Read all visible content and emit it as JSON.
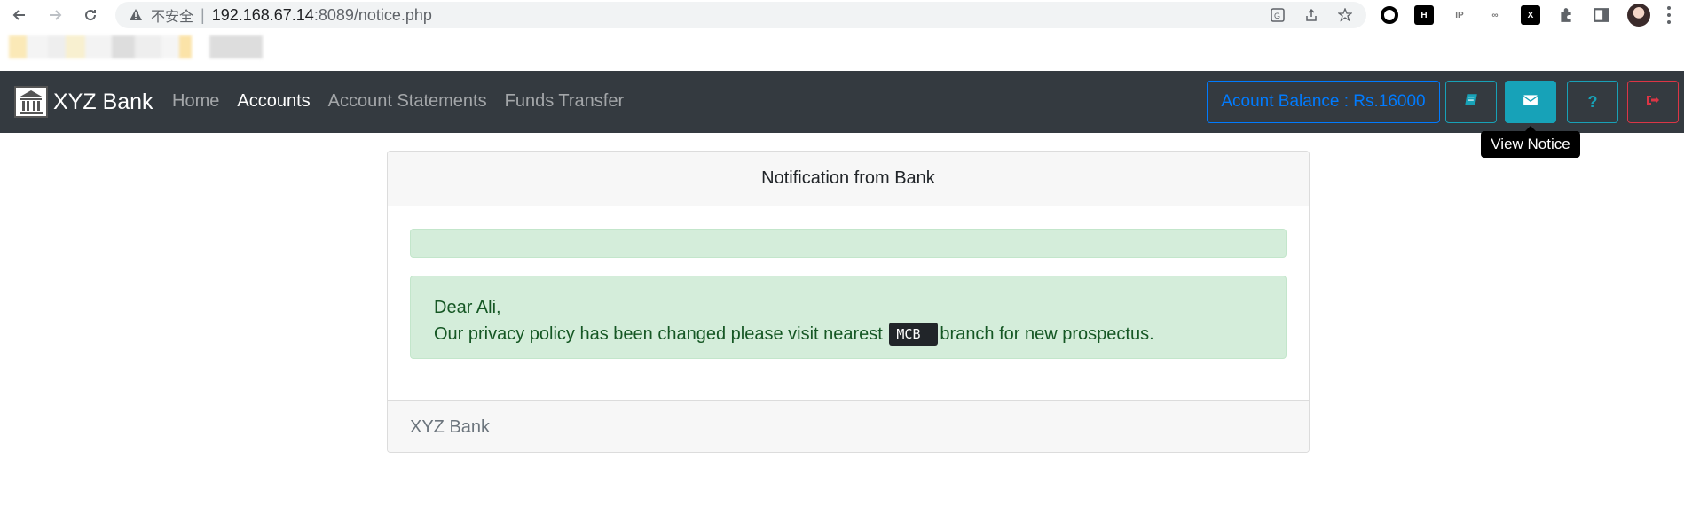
{
  "browser": {
    "insecure_label": "不安全",
    "separator": "|",
    "url_host": "192.168.67.14",
    "url_path": ":8089/notice.php",
    "extensions": [
      "H",
      "IP",
      "X"
    ]
  },
  "navbar": {
    "brand": "XYZ Bank",
    "links": [
      {
        "label": "Home",
        "active": false
      },
      {
        "label": "Accounts",
        "active": true
      },
      {
        "label": "Account Statements",
        "active": false
      },
      {
        "label": "Funds Transfer",
        "active": false
      }
    ],
    "balance_label": "Acount Balance : Rs.16000",
    "help_label": "?",
    "tooltip": "View Notice",
    "colors": {
      "bg": "#343a40",
      "info": "#17a2b8",
      "primary": "#007bff",
      "danger": "#dc3545"
    }
  },
  "card": {
    "header": "Notification from Bank",
    "greeting": "Dear Ali,",
    "message_before": "Our privacy policy has been changed please visit nearest",
    "bank_code": "MCB",
    "message_after": "branch for new prospectus.",
    "footer": "XYZ Bank",
    "alert_color": "#d4edda"
  }
}
